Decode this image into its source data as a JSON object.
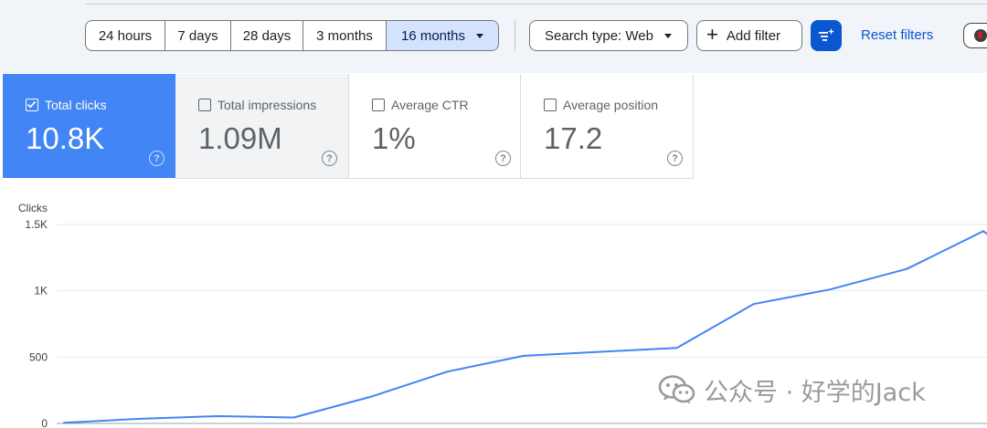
{
  "toolbar": {
    "date_ranges": [
      {
        "label": "24 hours",
        "active": false
      },
      {
        "label": "7 days",
        "active": false
      },
      {
        "label": "28 days",
        "active": false
      },
      {
        "label": "3 months",
        "active": false
      },
      {
        "label": "16 months",
        "active": true
      }
    ],
    "search_type": "Search type: Web",
    "add_filter": "Add filter",
    "reset_filters": "Reset filters"
  },
  "metrics": [
    {
      "label": "Total clicks",
      "value": "10.8K",
      "selected": true
    },
    {
      "label": "Total impressions",
      "value": "1.09M",
      "selected": false
    },
    {
      "label": "Average CTR",
      "value": "1%",
      "selected": false
    },
    {
      "label": "Average position",
      "value": "17.2",
      "selected": false
    }
  ],
  "help_glyph": "?",
  "chart_data": {
    "type": "line",
    "ylabel": "Clicks",
    "yticks": [
      {
        "value": 0,
        "label": "0"
      },
      {
        "value": 500,
        "label": "500"
      },
      {
        "value": 1000,
        "label": "1K"
      },
      {
        "value": 1500,
        "label": "1.5K"
      }
    ],
    "ylim": [
      0,
      1500
    ],
    "grid": true,
    "series": [
      {
        "color": "#4285f4",
        "values": [
          5,
          35,
          55,
          45,
          200,
          390,
          510,
          540,
          570,
          900,
          1010,
          1165,
          1450
        ]
      }
    ]
  },
  "watermark": {
    "text": "公众号 · 好学的Jack"
  }
}
